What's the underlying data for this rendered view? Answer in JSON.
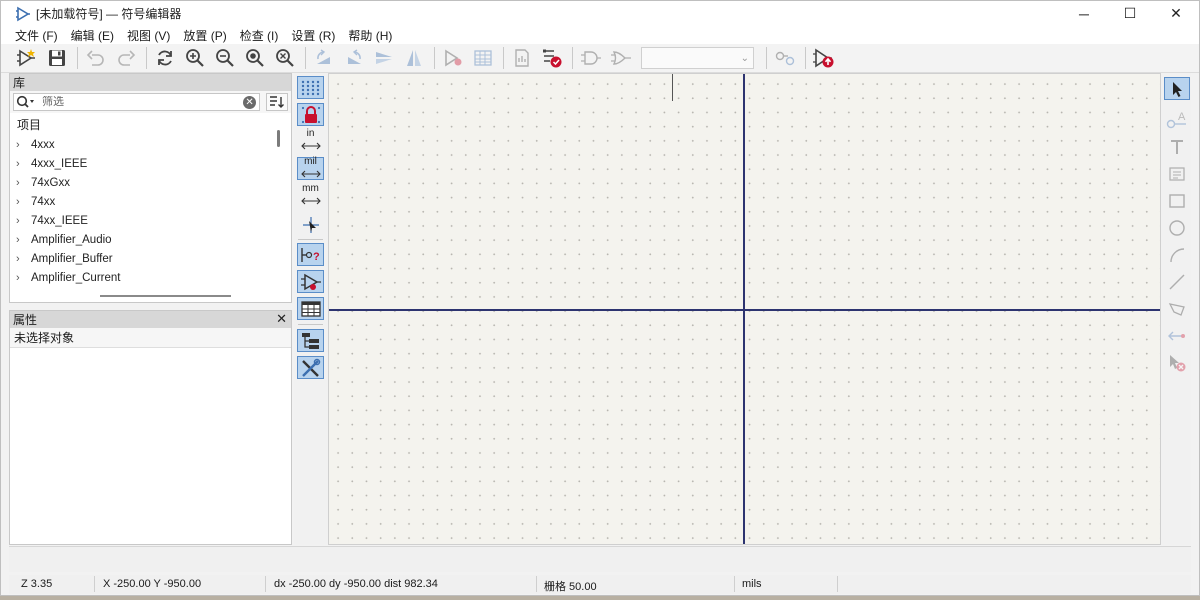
{
  "window": {
    "title": "[未加载符号] — 符号编辑器",
    "controls": {
      "minimize": "─",
      "maximize": "☐",
      "close": "✕"
    }
  },
  "menu": [
    "文件 (F)",
    "编辑 (E)",
    "视图 (V)",
    "放置 (P)",
    "检查 (I)",
    "设置 (R)",
    "帮助 (H)"
  ],
  "toolbar": {
    "unit_combo_value": ""
  },
  "library": {
    "header": "库",
    "filter_placeholder": "筛选",
    "filter_value": "",
    "tree_header": "项目",
    "items": [
      "4xxx",
      "4xxx_IEEE",
      "74xGxx",
      "74xx",
      "74xx_IEEE",
      "Amplifier_Audio",
      "Amplifier_Buffer",
      "Amplifier_Current"
    ]
  },
  "properties": {
    "header": "属性",
    "empty_text": "未选择对象"
  },
  "left_toolbar": {
    "unit_in": "in",
    "unit_mil": "mil",
    "unit_mm": "mm"
  },
  "status": {
    "zoom": "Z 3.35",
    "cursor": "X -250.00  Y -950.00",
    "delta": "dx -250.00  dy -950.00  dist 982.34",
    "grid": "栅格 50.00",
    "units": "mils"
  },
  "colors": {
    "axis": "#2d3470",
    "canvas_bg": "#f4f3ee",
    "active_button_bg": "#b8d3ee",
    "accent_red": "#c8102e",
    "icon_blue": "#3c6fb0"
  }
}
